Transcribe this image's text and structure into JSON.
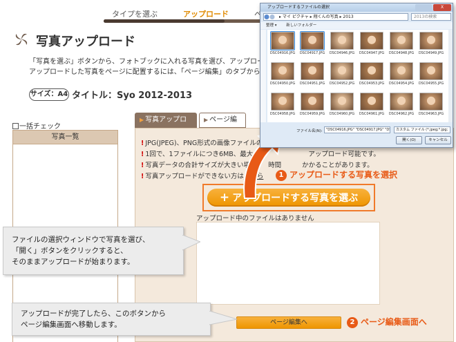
{
  "steps": {
    "items": [
      "タイプを選ぶ",
      "アップロード",
      "ペ"
    ]
  },
  "page": {
    "title": "写真アップロード",
    "intro_line1": "「写真を選ぶ」ボタンから、フォトブックに入れる写真を選び、アップロードします。",
    "intro_line2": "アップロードした写真をページに配置するには、「ページ編集」のタブから進んでくだ"
  },
  "book": {
    "size_badge": "サイズ：A4",
    "title": "タイトル：Syo 2012-2013"
  },
  "left_panel": {
    "bulk_check": "一括チェック",
    "header": "写真一覧"
  },
  "tabs": {
    "upload": "写真アップロード",
    "edit": "ページ編集"
  },
  "notes": {
    "line1": "JPG(JPEG)、PNG形式の画像ファイルの",
    "line2": "1回で、1ファイルにつき6MB、最大",
    "line2b": "アップロード可能です。",
    "line3": "写真データの合計サイズが大きい場",
    "line3b": "時間",
    "line3c": "かかることがあります。",
    "line4": "写真アップロードができない方は",
    "line4_link": "こちら"
  },
  "upload": {
    "select_button": "アップロードする写真を選ぶ",
    "select_plus": "+",
    "no_files": "アップロード中のファイルはありません",
    "edit_button": "ページ編集へ"
  },
  "callouts": {
    "c1_line1": "ファイルの選択ウィンドウで写真を選び、",
    "c1_line2": "「開く」ボタンをクリックすると、",
    "c1_line3": "そのままアップロードが始まります。",
    "c2_line1": "アップロードが完了したら、このボタンから",
    "c2_line2": "ページ編集画面へ移動します。"
  },
  "marks": {
    "m1_num": "1",
    "m1_text": "アップロードする写真を選択",
    "m2_num": "2",
    "m2_text": "ページ編集画面へ"
  },
  "dialog": {
    "title": "アップロードするファイルの選択",
    "close": "X",
    "address": "▸ マイ ピクチャ ▸ 翔くんの写真 ▸ 2013",
    "search_placeholder": "2013の検索",
    "toolbar_organize": "整理 ▾",
    "toolbar_new_folder": "新しいフォルダー",
    "files": [
      "DSC04916.JPG",
      "DSC04917.JPG",
      "DSC04946.JPG",
      "DSC04947.JPG",
      "DSC04948.JPG",
      "DSC04949.JPG",
      "DSC04950.JPG",
      "DSC04951.JPG",
      "DSC04952.JPG",
      "DSC04953.JPG",
      "DSC04954.JPG",
      "DSC04955.JPG",
      "DSC04958.JPG",
      "DSC04959.JPG",
      "DSC04960.JPG",
      "DSC04961.JPG",
      "DSC04962.JPG",
      "DSC04963.JPG"
    ],
    "filename_label": "ファイル名(N):",
    "filename_value": "\"DSC04916.JPG\" \"DSC04917.JPG\" \"DSC",
    "filetype_value": "カスタム ファイル (*.jpeg;*.jpg;",
    "open_button": "開く(O)",
    "cancel_button": "キャンセル"
  },
  "colors": {
    "accent_orange": "#ee9500",
    "annotation_orange": "#e85a16",
    "tab_brown": "#8a7260",
    "panel_beige": "#f4e9dc"
  }
}
